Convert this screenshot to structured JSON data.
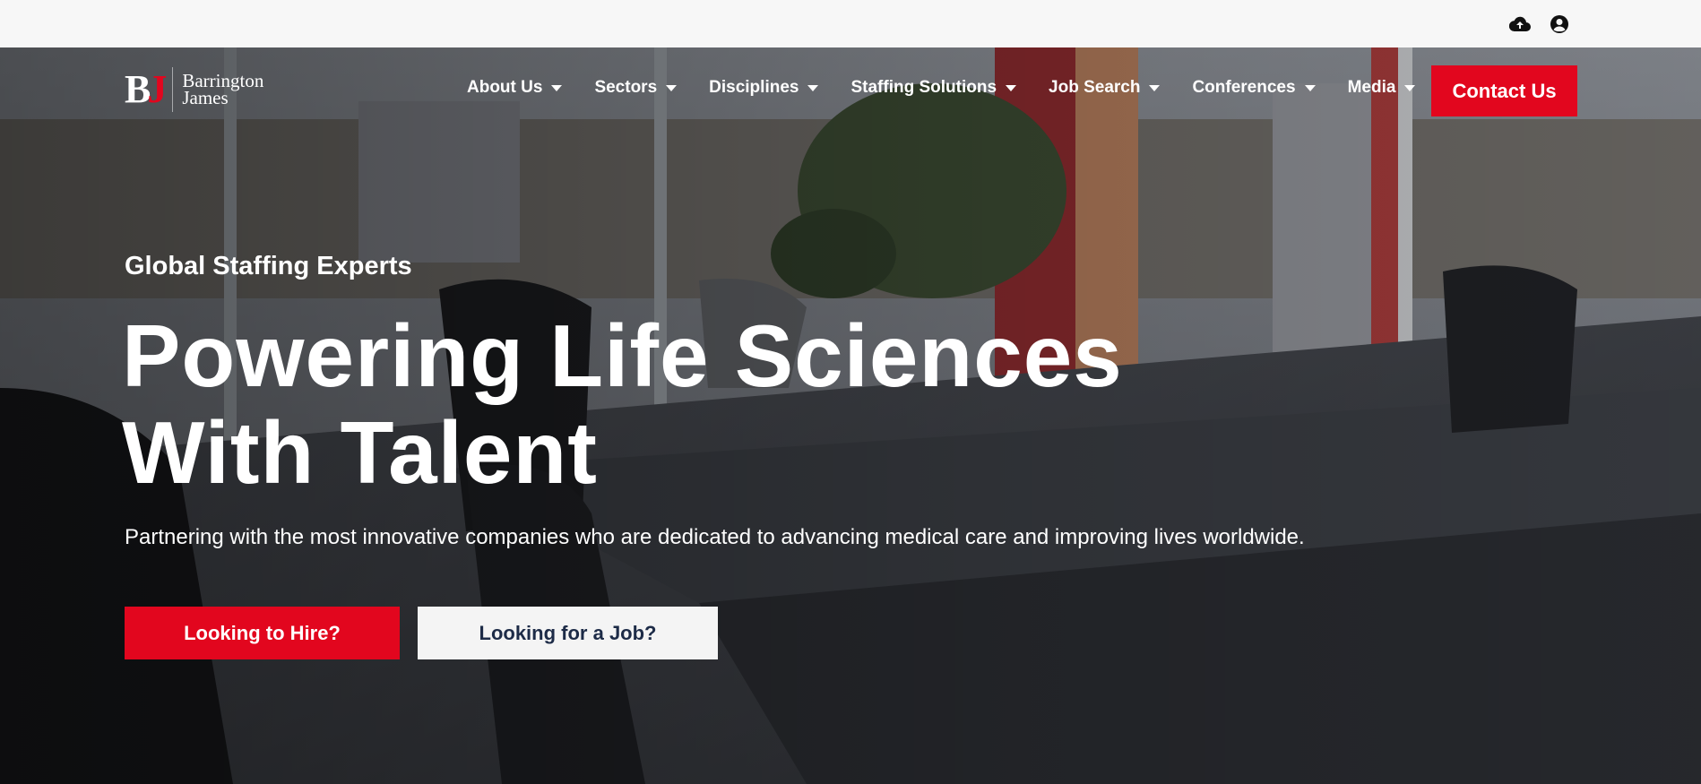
{
  "topbar": {
    "icons": [
      "cloud-upload-icon",
      "user-account-icon"
    ]
  },
  "logo": {
    "mark": "BJ",
    "mark_b": "B",
    "mark_j": "J",
    "line1": "Barrington",
    "line2": "James"
  },
  "nav": {
    "items": [
      {
        "label": "About Us"
      },
      {
        "label": "Sectors"
      },
      {
        "label": "Disciplines"
      },
      {
        "label": "Staffing Solutions"
      },
      {
        "label": "Job Search"
      },
      {
        "label": "Conferences"
      },
      {
        "label": "Media"
      }
    ],
    "contact_label": "Contact Us"
  },
  "hero": {
    "eyebrow": "Global Staffing Experts",
    "headline_line1": "Powering Life Sciences",
    "headline_line2": "With Talent",
    "subtext": "Partnering with the most innovative companies who are dedicated to advancing medical care and improving lives worldwide.",
    "hire_label": "Looking to Hire?",
    "job_label": "Looking for a Job?"
  },
  "colors": {
    "brand_red": "#e2061e",
    "navy": "#1d2b47",
    "topbar_bg": "#f7f7f7"
  }
}
